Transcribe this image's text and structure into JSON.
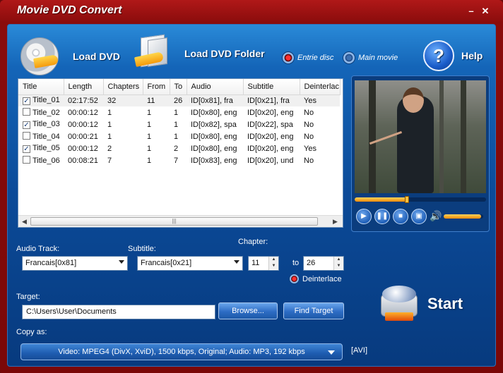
{
  "window": {
    "title": "Movie DVD Convert",
    "minimize_glyph": "–",
    "close_glyph": "✕"
  },
  "toolbar": {
    "load_dvd": "Load DVD",
    "load_dvd_folder": "Load DVD Folder",
    "entire_disc": "Entrie disc",
    "main_movie": "Main movie",
    "help": "Help",
    "help_glyph": "?"
  },
  "titles_table": {
    "columns": [
      "Title",
      "Length",
      "Chapters",
      "From",
      "To",
      "Audio",
      "Subtitle",
      "Deinterlac"
    ],
    "rows": [
      {
        "checked": true,
        "title": "Title_01",
        "length": "02:17:52",
        "chapters": "32",
        "from": "11",
        "to": "26",
        "audio": "ID[0x81], fra",
        "subtitle": "ID[0x21], fra",
        "deinterlace": "Yes"
      },
      {
        "checked": false,
        "title": "Title_02",
        "length": "00:00:12",
        "chapters": "1",
        "from": "1",
        "to": "1",
        "audio": "ID[0x80], eng",
        "subtitle": "ID[0x20], eng",
        "deinterlace": "No"
      },
      {
        "checked": true,
        "title": "Title_03",
        "length": "00:00:12",
        "chapters": "1",
        "from": "1",
        "to": "1",
        "audio": "ID[0x82], spa",
        "subtitle": "ID[0x22], spa",
        "deinterlace": "No"
      },
      {
        "checked": false,
        "title": "Title_04",
        "length": "00:00:21",
        "chapters": "1",
        "from": "1",
        "to": "1",
        "audio": "ID[0x80], eng",
        "subtitle": "ID[0x20], eng",
        "deinterlace": "No"
      },
      {
        "checked": true,
        "title": "Title_05",
        "length": "00:00:12",
        "chapters": "2",
        "from": "1",
        "to": "2",
        "audio": "ID[0x80], eng",
        "subtitle": "ID[0x20], eng",
        "deinterlace": "Yes"
      },
      {
        "checked": false,
        "title": "Title_06",
        "length": "00:08:21",
        "chapters": "7",
        "from": "1",
        "to": "7",
        "audio": "ID[0x83], eng",
        "subtitle": "ID[0x20], und",
        "deinterlace": "No"
      }
    ]
  },
  "player": {
    "seek_progress": 0.4,
    "volume": 0.95
  },
  "options": {
    "audio_track_label": "Audio Track:",
    "audio_track_value": "Francais[0x81]",
    "subtitle_label": "Subtitle:",
    "subtitle_value": "Francais[0x21]",
    "chapter_label": "Chapter:",
    "chapter_from": "11",
    "chapter_to_label": "to",
    "chapter_to": "26",
    "deinterlace_label": "Deinterlace"
  },
  "target": {
    "label": "Target:",
    "path": "C:\\Users\\User\\Documents",
    "browse": "Browse...",
    "find_target": "Find Target"
  },
  "start_label": "Start",
  "copy_as": {
    "label": "Copy as:",
    "format": "Video: MPEG4 (DivX, XviD), 1500 kbps, Original; Audio: MP3, 192 kbps",
    "extension": "[AVI]"
  },
  "colors": {
    "accent": "#f59a0b",
    "frame": "#8a0c0c",
    "panel": "#1465b8"
  }
}
